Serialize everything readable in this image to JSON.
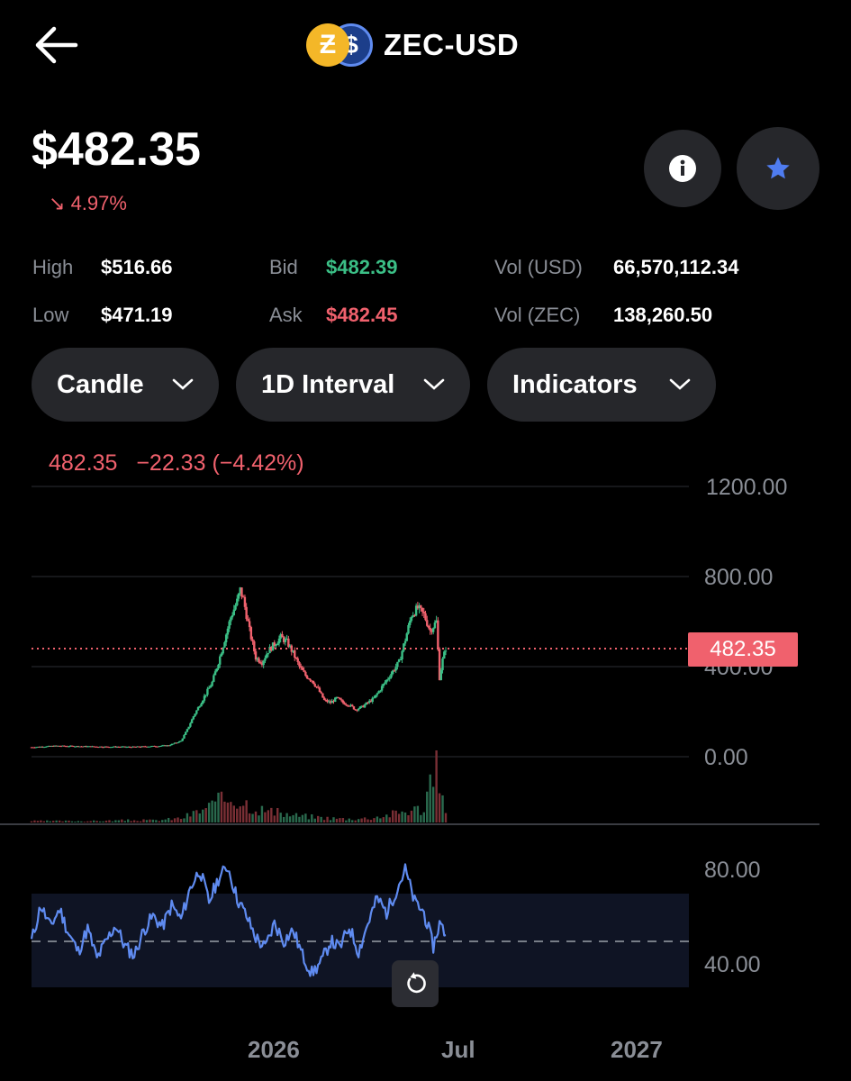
{
  "header": {
    "title": "ZEC-USD",
    "base_coin_symbol": "Ƶ",
    "quote_coin_symbol": "$"
  },
  "price": {
    "value": "$482.35",
    "change_arrow": "↘",
    "change_pct": "4.97%"
  },
  "stats": {
    "high_label": "High",
    "high_value": "$516.66",
    "low_label": "Low",
    "low_value": "$471.19",
    "bid_label": "Bid",
    "bid_value": "$482.39",
    "ask_label": "Ask",
    "ask_value": "$482.45",
    "vol_usd_label": "Vol (USD)",
    "vol_usd_value": "66,570,112.34",
    "vol_zec_label": "Vol (ZEC)",
    "vol_zec_value": "138,260.50"
  },
  "controls": {
    "chart_type": "Candle",
    "interval": "1D Interval",
    "indicators": "Indicators"
  },
  "legend": {
    "close": "482.35",
    "change": "−22.33",
    "change_pct": "(−4.42%)"
  },
  "price_axis": [
    "1200.00",
    "800.00",
    "400.00",
    "0.00"
  ],
  "current_price_tag": "482.35",
  "rsi_axis": [
    "80.00",
    "40.00"
  ],
  "x_axis": [
    "2026",
    "Jul",
    "2027"
  ],
  "colors": {
    "up": "#3bbf86",
    "down": "#f0616d",
    "rsi": "#5f8bf0",
    "accent_blue": "#4f7cf0",
    "bg": "#000000"
  },
  "icons": [
    "back-arrow-icon",
    "info-icon",
    "star-icon",
    "chevron-down-icon",
    "reset-icon"
  ],
  "chart_data": {
    "type": "candlestick",
    "price_axis_range": [
      0,
      1200
    ],
    "rsi_axis_range": [
      20,
      100
    ],
    "rsi_midline": 50,
    "current_price": 482.35,
    "price_series": [
      {
        "d": 0,
        "c": 42
      },
      {
        "d": 4,
        "c": 45
      },
      {
        "d": 8,
        "c": 48
      },
      {
        "d": 12,
        "c": 47
      },
      {
        "d": 16,
        "c": 46
      },
      {
        "d": 20,
        "c": 45
      },
      {
        "d": 24,
        "c": 44
      },
      {
        "d": 28,
        "c": 44
      },
      {
        "d": 32,
        "c": 43
      },
      {
        "d": 36,
        "c": 45
      },
      {
        "d": 40,
        "c": 47
      },
      {
        "d": 44,
        "c": 50
      },
      {
        "d": 48,
        "c": 70
      },
      {
        "d": 50,
        "c": 120
      },
      {
        "d": 52,
        "c": 180
      },
      {
        "d": 54,
        "c": 230
      },
      {
        "d": 56,
        "c": 280
      },
      {
        "d": 58,
        "c": 330
      },
      {
        "d": 60,
        "c": 420
      },
      {
        "d": 62,
        "c": 520
      },
      {
        "d": 64,
        "c": 620
      },
      {
        "d": 66,
        "c": 690
      },
      {
        "d": 67,
        "c": 740
      },
      {
        "d": 68,
        "c": 700
      },
      {
        "d": 70,
        "c": 560
      },
      {
        "d": 72,
        "c": 440
      },
      {
        "d": 74,
        "c": 420
      },
      {
        "d": 76,
        "c": 470
      },
      {
        "d": 78,
        "c": 500
      },
      {
        "d": 80,
        "c": 530
      },
      {
        "d": 82,
        "c": 510
      },
      {
        "d": 84,
        "c": 460
      },
      {
        "d": 86,
        "c": 400
      },
      {
        "d": 88,
        "c": 360
      },
      {
        "d": 90,
        "c": 340
      },
      {
        "d": 92,
        "c": 300
      },
      {
        "d": 94,
        "c": 250
      },
      {
        "d": 96,
        "c": 240
      },
      {
        "d": 98,
        "c": 260
      },
      {
        "d": 100,
        "c": 240
      },
      {
        "d": 102,
        "c": 230
      },
      {
        "d": 104,
        "c": 210
      },
      {
        "d": 106,
        "c": 220
      },
      {
        "d": 108,
        "c": 240
      },
      {
        "d": 110,
        "c": 260
      },
      {
        "d": 112,
        "c": 300
      },
      {
        "d": 114,
        "c": 340
      },
      {
        "d": 116,
        "c": 380
      },
      {
        "d": 118,
        "c": 420
      },
      {
        "d": 120,
        "c": 520
      },
      {
        "d": 122,
        "c": 630
      },
      {
        "d": 124,
        "c": 660
      },
      {
        "d": 126,
        "c": 630
      },
      {
        "d": 128,
        "c": 560
      },
      {
        "d": 130,
        "c": 600
      },
      {
        "d": 131,
        "c": 350
      },
      {
        "d": 132,
        "c": 430
      },
      {
        "d": 133,
        "c": 482.35
      }
    ],
    "rsi_series": [
      {
        "d": 0,
        "v": 48
      },
      {
        "d": 3,
        "v": 68
      },
      {
        "d": 6,
        "v": 56
      },
      {
        "d": 9,
        "v": 66
      },
      {
        "d": 12,
        "v": 52
      },
      {
        "d": 15,
        "v": 42
      },
      {
        "d": 18,
        "v": 55
      },
      {
        "d": 21,
        "v": 38
      },
      {
        "d": 24,
        "v": 48
      },
      {
        "d": 27,
        "v": 57
      },
      {
        "d": 30,
        "v": 45
      },
      {
        "d": 33,
        "v": 40
      },
      {
        "d": 36,
        "v": 54
      },
      {
        "d": 39,
        "v": 62
      },
      {
        "d": 42,
        "v": 56
      },
      {
        "d": 45,
        "v": 68
      },
      {
        "d": 48,
        "v": 60
      },
      {
        "d": 51,
        "v": 78
      },
      {
        "d": 54,
        "v": 88
      },
      {
        "d": 57,
        "v": 70
      },
      {
        "d": 60,
        "v": 83
      },
      {
        "d": 63,
        "v": 90
      },
      {
        "d": 66,
        "v": 72
      },
      {
        "d": 69,
        "v": 62
      },
      {
        "d": 72,
        "v": 50
      },
      {
        "d": 75,
        "v": 44
      },
      {
        "d": 78,
        "v": 58
      },
      {
        "d": 81,
        "v": 48
      },
      {
        "d": 84,
        "v": 54
      },
      {
        "d": 87,
        "v": 40
      },
      {
        "d": 90,
        "v": 30
      },
      {
        "d": 93,
        "v": 36
      },
      {
        "d": 96,
        "v": 48
      },
      {
        "d": 99,
        "v": 44
      },
      {
        "d": 102,
        "v": 56
      },
      {
        "d": 105,
        "v": 42
      },
      {
        "d": 108,
        "v": 58
      },
      {
        "d": 111,
        "v": 72
      },
      {
        "d": 114,
        "v": 64
      },
      {
        "d": 117,
        "v": 76
      },
      {
        "d": 120,
        "v": 88
      },
      {
        "d": 123,
        "v": 70
      },
      {
        "d": 126,
        "v": 64
      },
      {
        "d": 129,
        "v": 45
      },
      {
        "d": 131,
        "v": 58
      },
      {
        "d": 133,
        "v": 52
      }
    ],
    "volume_series": [
      {
        "d": 0,
        "v": 2
      },
      {
        "d": 10,
        "v": 2
      },
      {
        "d": 20,
        "v": 2
      },
      {
        "d": 30,
        "v": 3
      },
      {
        "d": 40,
        "v": 3
      },
      {
        "d": 48,
        "v": 6
      },
      {
        "d": 54,
        "v": 16
      },
      {
        "d": 60,
        "v": 28
      },
      {
        "d": 64,
        "v": 36
      },
      {
        "d": 68,
        "v": 30
      },
      {
        "d": 72,
        "v": 20
      },
      {
        "d": 78,
        "v": 14
      },
      {
        "d": 84,
        "v": 10
      },
      {
        "d": 90,
        "v": 8
      },
      {
        "d": 96,
        "v": 6
      },
      {
        "d": 102,
        "v": 5
      },
      {
        "d": 108,
        "v": 6
      },
      {
        "d": 114,
        "v": 10
      },
      {
        "d": 120,
        "v": 16
      },
      {
        "d": 126,
        "v": 20
      },
      {
        "d": 130,
        "v": 100
      },
      {
        "d": 131,
        "v": 40
      },
      {
        "d": 133,
        "v": 18
      }
    ]
  }
}
